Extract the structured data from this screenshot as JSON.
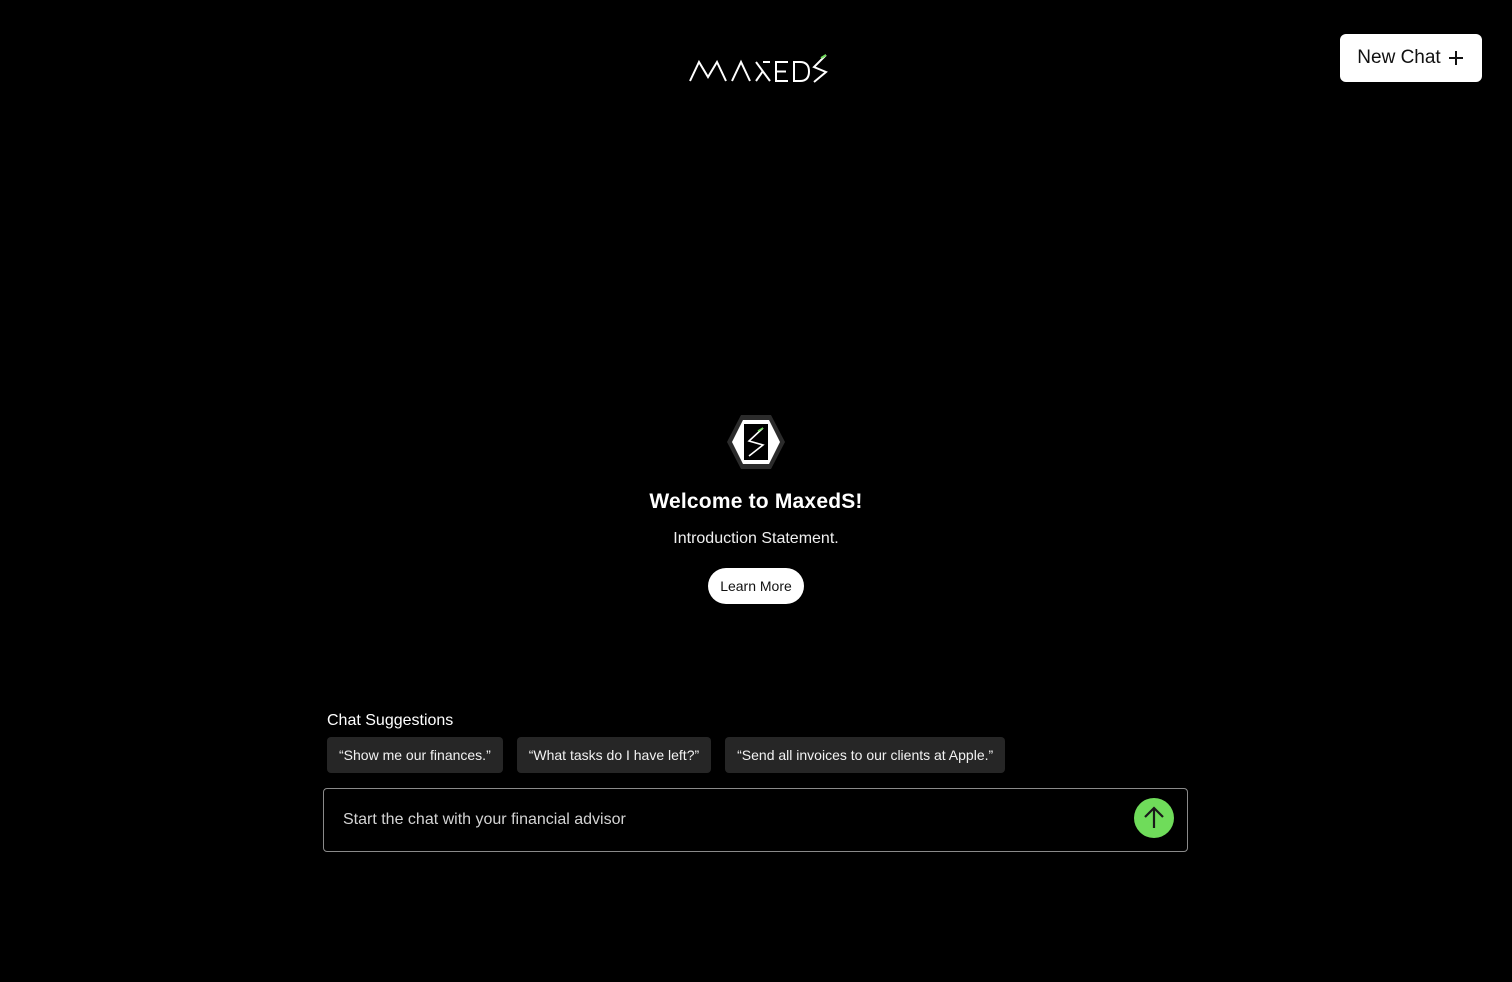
{
  "header": {
    "logo_icon": "maxeds-wordmark-icon",
    "logo_text": "MAXEDS",
    "new_chat_label": "New Chat",
    "new_chat_icon": "plus-icon"
  },
  "welcome": {
    "badge_icon": "maxeds-hexagon-badge-icon",
    "title": "Welcome to MaxedS!",
    "subtitle": "Introduction Statement.",
    "learn_more_label": "Learn More"
  },
  "suggestions": {
    "title": "Chat Suggestions",
    "items": [
      "“Show me our finances.”",
      "“What tasks do I have left?”",
      "“Send all invoices to our clients at Apple.”"
    ]
  },
  "chat": {
    "placeholder": "Start the chat with your financial advisor",
    "value": "",
    "send_icon": "arrow-up-icon"
  },
  "colors": {
    "background": "#000000",
    "accent": "#6fdc5a",
    "chip_bg": "#262626",
    "button_bg": "#ffffff"
  }
}
